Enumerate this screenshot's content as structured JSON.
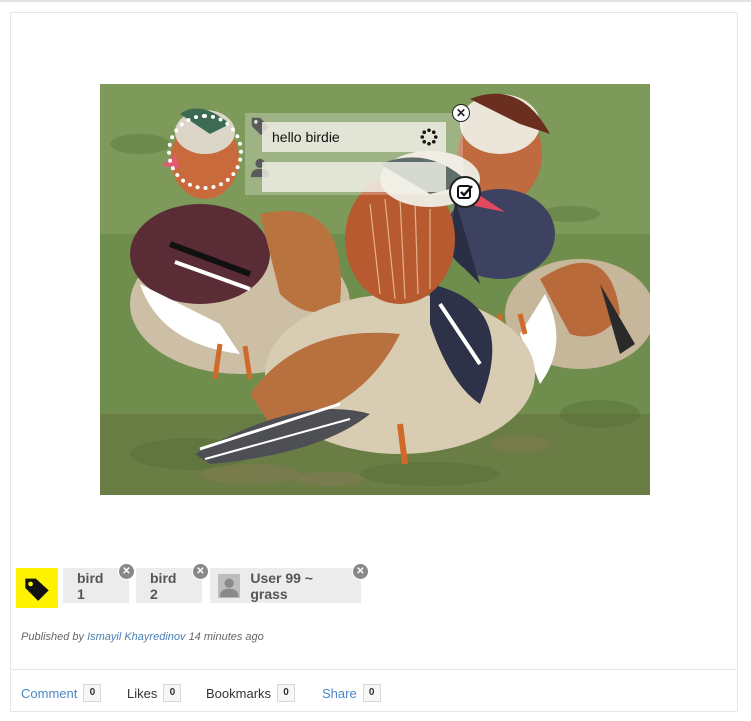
{
  "photo": {
    "description_icon": "mandarin-ducks-photo"
  },
  "tagger": {
    "tag_input_value": "hello birdie",
    "person_input_value": "",
    "icons": {
      "tag": "tag-icon",
      "person": "person-icon",
      "loading": "spinner-icon",
      "close": "close-icon",
      "confirm": "check-icon"
    }
  },
  "tags": {
    "icon": "tag-icon",
    "accent": "#fff200",
    "items": [
      {
        "label": "bird 1"
      },
      {
        "label": "bird 2"
      },
      {
        "label": "User 99 ~ grass",
        "has_avatar": true
      }
    ]
  },
  "meta": {
    "prefix": "Published by",
    "author": "Ismayil Khayredinov",
    "time": "14 minutes ago"
  },
  "footer": {
    "comment_label": "Comment",
    "comment_count": "0",
    "likes_label": "Likes",
    "likes_count": "0",
    "bookmarks_label": "Bookmarks",
    "bookmarks_count": "0",
    "share_label": "Share",
    "share_count": "0",
    "link_color": "#4a86c5"
  }
}
